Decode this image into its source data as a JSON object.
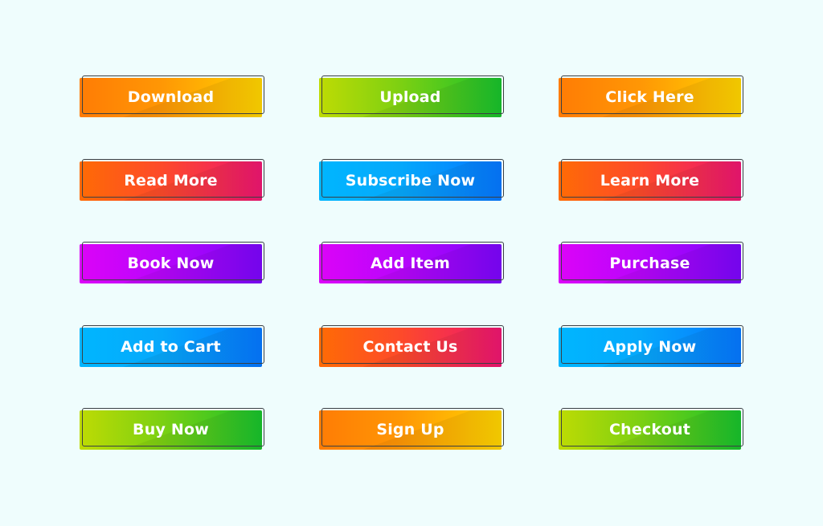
{
  "background_color": "#effdfd",
  "buttons": [
    {
      "label": "Download",
      "gradient": "orange-yellow",
      "colors": [
        "#ff7c05",
        "#ffd400"
      ]
    },
    {
      "label": "Upload",
      "gradient": "lime-green",
      "colors": [
        "#bedb04",
        "#17c12c"
      ]
    },
    {
      "label": "Click Here",
      "gradient": "orange-yellow",
      "colors": [
        "#ff7c05",
        "#ffd400"
      ]
    },
    {
      "label": "Read More",
      "gradient": "orange-pink",
      "colors": [
        "#ff6b05",
        "#ee1571"
      ]
    },
    {
      "label": "Subscribe Now",
      "gradient": "cyan-blue",
      "colors": [
        "#00b6ff",
        "#0577ff"
      ]
    },
    {
      "label": "Learn More",
      "gradient": "orange-pink",
      "colors": [
        "#ff6b05",
        "#ee1571"
      ]
    },
    {
      "label": "Book Now",
      "gradient": "magenta-violet",
      "colors": [
        "#dc04f8",
        "#7b05fb"
      ]
    },
    {
      "label": "Add Item",
      "gradient": "magenta-violet",
      "colors": [
        "#dc04f8",
        "#7b05fb"
      ]
    },
    {
      "label": "Purchase",
      "gradient": "magenta-violet",
      "colors": [
        "#dc04f8",
        "#7b05fb"
      ]
    },
    {
      "label": "Add to Cart",
      "gradient": "cyan-blue",
      "colors": [
        "#00b6ff",
        "#0577ff"
      ]
    },
    {
      "label": "Contact Us",
      "gradient": "orange-pink",
      "colors": [
        "#ff6b05",
        "#ee1571"
      ]
    },
    {
      "label": "Apply Now",
      "gradient": "cyan-blue",
      "colors": [
        "#00b6ff",
        "#0577ff"
      ]
    },
    {
      "label": "Buy Now",
      "gradient": "lime-green",
      "colors": [
        "#bedb04",
        "#17c12c"
      ]
    },
    {
      "label": "Sign Up",
      "gradient": "orange-yellow",
      "colors": [
        "#ff7c05",
        "#ffd400"
      ]
    },
    {
      "label": "Checkout",
      "gradient": "lime-green",
      "colors": [
        "#bedb04",
        "#17c12c"
      ]
    }
  ]
}
